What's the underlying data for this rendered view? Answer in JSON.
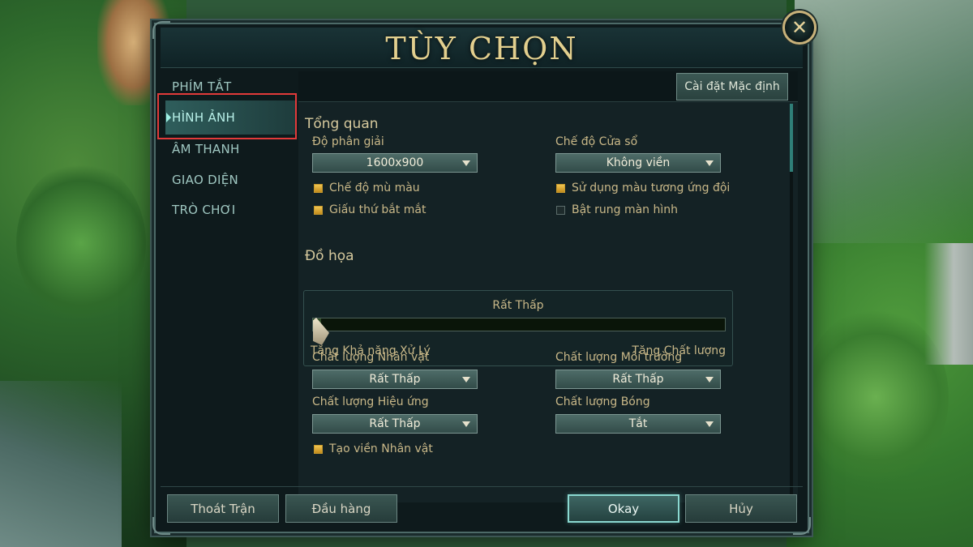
{
  "dialog": {
    "title": "TÙY CHỌN"
  },
  "sidebar": {
    "items": [
      {
        "label": "PHÍM TẮT"
      },
      {
        "label": "HÌNH ẢNH",
        "active": true
      },
      {
        "label": "ÂM THANH"
      },
      {
        "label": "GIAO DIỆN"
      },
      {
        "label": "TRÒ CHƠI"
      }
    ]
  },
  "toolbar": {
    "reset_label": "Cài đặt Mặc định"
  },
  "overview": {
    "title": "Tổng quan",
    "resolution": {
      "label": "Độ phân giải",
      "value": "1600x900"
    },
    "window_mode": {
      "label": "Chế độ Cửa sổ",
      "value": "Không viền"
    },
    "checkboxes": [
      {
        "label": "Chế độ mù màu",
        "checked": true
      },
      {
        "label": "Giấu thứ bắt mắt",
        "checked": true
      },
      {
        "label": "Sử dụng màu tương ứng đội",
        "checked": true
      },
      {
        "label": "Bật rung màn hình",
        "checked": false
      }
    ]
  },
  "graphics": {
    "title": "Đồ họa",
    "level_label": "Rất Thấp",
    "level_fraction": 0.0,
    "left_label": "Tăng Khả năng Xử Lý",
    "right_label": "Tăng Chất lượng",
    "character_quality": {
      "label": "Chất lượng Nhân vật",
      "value": "Rất Thấp"
    },
    "environment_quality": {
      "label": "Chất lượng Môi trường",
      "value": "Rất Thấp"
    },
    "effects_quality": {
      "label": "Chất lượng Hiệu ứng",
      "value": "Rất Thấp"
    },
    "shadow_quality": {
      "label": "Chất lượng Bóng",
      "value": "Tắt"
    },
    "character_outline": {
      "label": "Tạo viền Nhân vật",
      "checked": true
    }
  },
  "footer": {
    "leave_label": "Thoát Trận",
    "surrender_label": "Đầu hàng",
    "ok_label": "Okay",
    "cancel_label": "Hủy"
  },
  "icons": {
    "close": "close-icon",
    "dropdown": "chevron-down-icon"
  },
  "colors": {
    "accent": "#e2cf8e",
    "highlight": "#e23a3a",
    "checkbox": "#f1c552"
  }
}
